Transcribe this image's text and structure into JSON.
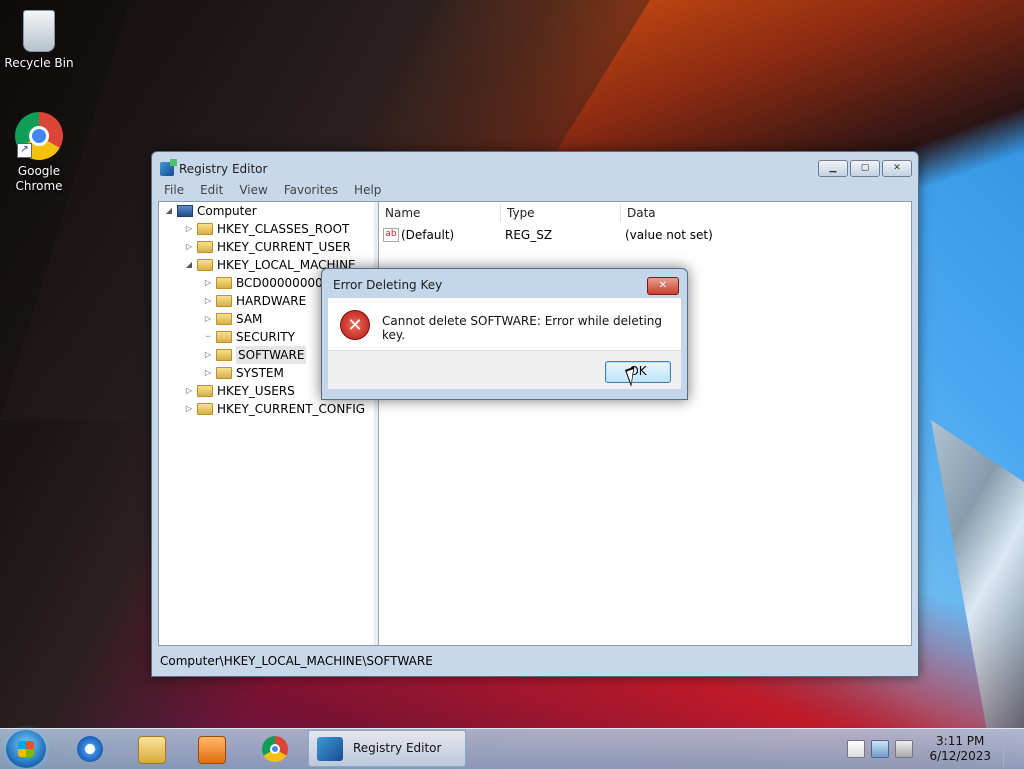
{
  "desktop": {
    "icons": [
      {
        "label": "Recycle Bin",
        "icon": "recycle-bin-icon"
      },
      {
        "label": "Google Chrome",
        "icon": "chrome-icon"
      }
    ]
  },
  "registry_window": {
    "title": "Registry Editor",
    "menu": [
      "File",
      "Edit",
      "View",
      "Favorites",
      "Help"
    ],
    "tree": {
      "root": "Computer",
      "items": [
        {
          "label": "HKEY_CLASSES_ROOT",
          "expander": "collapsed"
        },
        {
          "label": "HKEY_CURRENT_USER",
          "expander": "collapsed"
        },
        {
          "label": "HKEY_LOCAL_MACHINE",
          "expander": "expanded"
        },
        {
          "label": "BCD00000000",
          "expander": "collapsed"
        },
        {
          "label": "HARDWARE",
          "expander": "collapsed"
        },
        {
          "label": "SAM",
          "expander": "collapsed"
        },
        {
          "label": "SECURITY",
          "expander": "none"
        },
        {
          "label": "SOFTWARE",
          "expander": "collapsed",
          "selected": true
        },
        {
          "label": "SYSTEM",
          "expander": "collapsed"
        },
        {
          "label": "HKEY_USERS",
          "expander": "collapsed"
        },
        {
          "label": "HKEY_CURRENT_CONFIG",
          "expander": "collapsed"
        }
      ]
    },
    "columns": {
      "name": "Name",
      "type": "Type",
      "data": "Data"
    },
    "values": [
      {
        "name": "(Default)",
        "type": "REG_SZ",
        "data": "(value not set)"
      }
    ],
    "status_path": "Computer\\HKEY_LOCAL_MACHINE\\SOFTWARE"
  },
  "error_dialog": {
    "title": "Error Deleting Key",
    "message": "Cannot delete SOFTWARE:  Error while deleting key.",
    "ok_label": "OK",
    "close_glyph": "✕",
    "error_glyph": "✕"
  },
  "taskbar": {
    "pinned": [
      "internet-explorer-icon",
      "file-explorer-icon",
      "media-player-icon",
      "chrome-icon"
    ],
    "active_app_label": "Registry Editor",
    "tray_icons": [
      "action-center-flag-icon",
      "network-icon",
      "volume-muted-icon"
    ],
    "time": "3:11 PM",
    "date": "6/12/2023"
  },
  "colors": {
    "ok_button_border": "#3c7fb1",
    "error_red": "#b01a12",
    "titlebar": "#c7d8ea"
  }
}
